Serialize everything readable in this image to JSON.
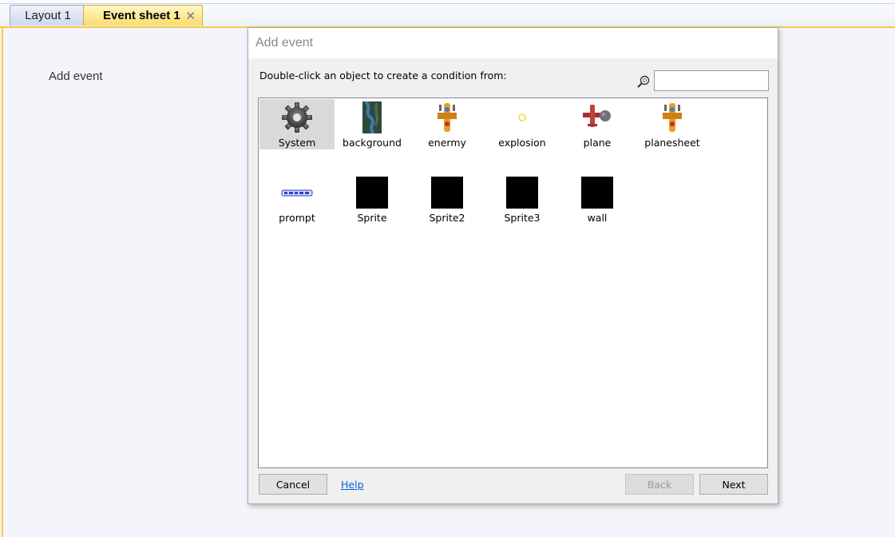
{
  "tabs": [
    {
      "label": "Layout 1",
      "active": false
    },
    {
      "label": "Event sheet 1",
      "active": true,
      "close_glyph": "✕"
    }
  ],
  "editor": {
    "add_event_label": "Add event"
  },
  "dialog": {
    "title": "Add event",
    "instruction": "Double-click an object to create a condition from:",
    "search": {
      "value": "",
      "placeholder": ""
    },
    "objects": [
      {
        "name": "System",
        "icon": "gear-icon",
        "selected": true
      },
      {
        "name": "background",
        "icon": "background-thumbnail-icon",
        "selected": false
      },
      {
        "name": "enermy",
        "icon": "enemy-sprite-icon",
        "selected": false
      },
      {
        "name": "explosion",
        "icon": "explosion-sprite-icon",
        "selected": false
      },
      {
        "name": "plane",
        "icon": "plane-sprite-icon",
        "selected": false
      },
      {
        "name": "planesheet",
        "icon": "planesheet-sprite-icon",
        "selected": false
      },
      {
        "name": "prompt",
        "icon": "prompt-text-icon",
        "selected": false
      },
      {
        "name": "Sprite",
        "icon": "black-sprite-icon",
        "selected": false
      },
      {
        "name": "Sprite2",
        "icon": "black-sprite-icon",
        "selected": false
      },
      {
        "name": "Sprite3",
        "icon": "black-sprite-icon",
        "selected": false
      },
      {
        "name": "wall",
        "icon": "black-sprite-icon",
        "selected": false
      }
    ],
    "buttons": {
      "cancel": "Cancel",
      "help": "Help",
      "back": "Back",
      "next": "Next"
    }
  },
  "colors": {
    "tab_active": "#f9dc6b",
    "accent_border": "#f5c94a",
    "link": "#0066cc",
    "selection": "#d9d9d9"
  }
}
